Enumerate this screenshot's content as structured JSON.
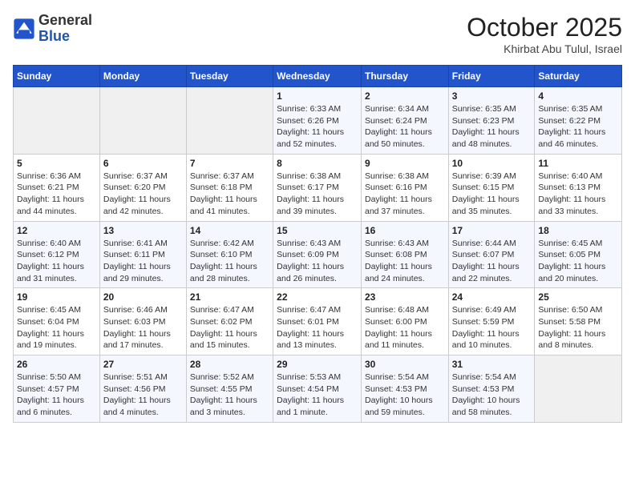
{
  "header": {
    "logo_general": "General",
    "logo_blue": "Blue",
    "month_title": "October 2025",
    "location": "Khirbat Abu Tulul, Israel"
  },
  "weekdays": [
    "Sunday",
    "Monday",
    "Tuesday",
    "Wednesday",
    "Thursday",
    "Friday",
    "Saturday"
  ],
  "weeks": [
    [
      {
        "day": "",
        "info": ""
      },
      {
        "day": "",
        "info": ""
      },
      {
        "day": "",
        "info": ""
      },
      {
        "day": "1",
        "info": "Sunrise: 6:33 AM\nSunset: 6:26 PM\nDaylight: 11 hours\nand 52 minutes."
      },
      {
        "day": "2",
        "info": "Sunrise: 6:34 AM\nSunset: 6:24 PM\nDaylight: 11 hours\nand 50 minutes."
      },
      {
        "day": "3",
        "info": "Sunrise: 6:35 AM\nSunset: 6:23 PM\nDaylight: 11 hours\nand 48 minutes."
      },
      {
        "day": "4",
        "info": "Sunrise: 6:35 AM\nSunset: 6:22 PM\nDaylight: 11 hours\nand 46 minutes."
      }
    ],
    [
      {
        "day": "5",
        "info": "Sunrise: 6:36 AM\nSunset: 6:21 PM\nDaylight: 11 hours\nand 44 minutes."
      },
      {
        "day": "6",
        "info": "Sunrise: 6:37 AM\nSunset: 6:20 PM\nDaylight: 11 hours\nand 42 minutes."
      },
      {
        "day": "7",
        "info": "Sunrise: 6:37 AM\nSunset: 6:18 PM\nDaylight: 11 hours\nand 41 minutes."
      },
      {
        "day": "8",
        "info": "Sunrise: 6:38 AM\nSunset: 6:17 PM\nDaylight: 11 hours\nand 39 minutes."
      },
      {
        "day": "9",
        "info": "Sunrise: 6:38 AM\nSunset: 6:16 PM\nDaylight: 11 hours\nand 37 minutes."
      },
      {
        "day": "10",
        "info": "Sunrise: 6:39 AM\nSunset: 6:15 PM\nDaylight: 11 hours\nand 35 minutes."
      },
      {
        "day": "11",
        "info": "Sunrise: 6:40 AM\nSunset: 6:13 PM\nDaylight: 11 hours\nand 33 minutes."
      }
    ],
    [
      {
        "day": "12",
        "info": "Sunrise: 6:40 AM\nSunset: 6:12 PM\nDaylight: 11 hours\nand 31 minutes."
      },
      {
        "day": "13",
        "info": "Sunrise: 6:41 AM\nSunset: 6:11 PM\nDaylight: 11 hours\nand 29 minutes."
      },
      {
        "day": "14",
        "info": "Sunrise: 6:42 AM\nSunset: 6:10 PM\nDaylight: 11 hours\nand 28 minutes."
      },
      {
        "day": "15",
        "info": "Sunrise: 6:43 AM\nSunset: 6:09 PM\nDaylight: 11 hours\nand 26 minutes."
      },
      {
        "day": "16",
        "info": "Sunrise: 6:43 AM\nSunset: 6:08 PM\nDaylight: 11 hours\nand 24 minutes."
      },
      {
        "day": "17",
        "info": "Sunrise: 6:44 AM\nSunset: 6:07 PM\nDaylight: 11 hours\nand 22 minutes."
      },
      {
        "day": "18",
        "info": "Sunrise: 6:45 AM\nSunset: 6:05 PM\nDaylight: 11 hours\nand 20 minutes."
      }
    ],
    [
      {
        "day": "19",
        "info": "Sunrise: 6:45 AM\nSunset: 6:04 PM\nDaylight: 11 hours\nand 19 minutes."
      },
      {
        "day": "20",
        "info": "Sunrise: 6:46 AM\nSunset: 6:03 PM\nDaylight: 11 hours\nand 17 minutes."
      },
      {
        "day": "21",
        "info": "Sunrise: 6:47 AM\nSunset: 6:02 PM\nDaylight: 11 hours\nand 15 minutes."
      },
      {
        "day": "22",
        "info": "Sunrise: 6:47 AM\nSunset: 6:01 PM\nDaylight: 11 hours\nand 13 minutes."
      },
      {
        "day": "23",
        "info": "Sunrise: 6:48 AM\nSunset: 6:00 PM\nDaylight: 11 hours\nand 11 minutes."
      },
      {
        "day": "24",
        "info": "Sunrise: 6:49 AM\nSunset: 5:59 PM\nDaylight: 11 hours\nand 10 minutes."
      },
      {
        "day": "25",
        "info": "Sunrise: 6:50 AM\nSunset: 5:58 PM\nDaylight: 11 hours\nand 8 minutes."
      }
    ],
    [
      {
        "day": "26",
        "info": "Sunrise: 5:50 AM\nSunset: 4:57 PM\nDaylight: 11 hours\nand 6 minutes."
      },
      {
        "day": "27",
        "info": "Sunrise: 5:51 AM\nSunset: 4:56 PM\nDaylight: 11 hours\nand 4 minutes."
      },
      {
        "day": "28",
        "info": "Sunrise: 5:52 AM\nSunset: 4:55 PM\nDaylight: 11 hours\nand 3 minutes."
      },
      {
        "day": "29",
        "info": "Sunrise: 5:53 AM\nSunset: 4:54 PM\nDaylight: 11 hours\nand 1 minute."
      },
      {
        "day": "30",
        "info": "Sunrise: 5:54 AM\nSunset: 4:53 PM\nDaylight: 10 hours\nand 59 minutes."
      },
      {
        "day": "31",
        "info": "Sunrise: 5:54 AM\nSunset: 4:53 PM\nDaylight: 10 hours\nand 58 minutes."
      },
      {
        "day": "",
        "info": ""
      }
    ]
  ]
}
